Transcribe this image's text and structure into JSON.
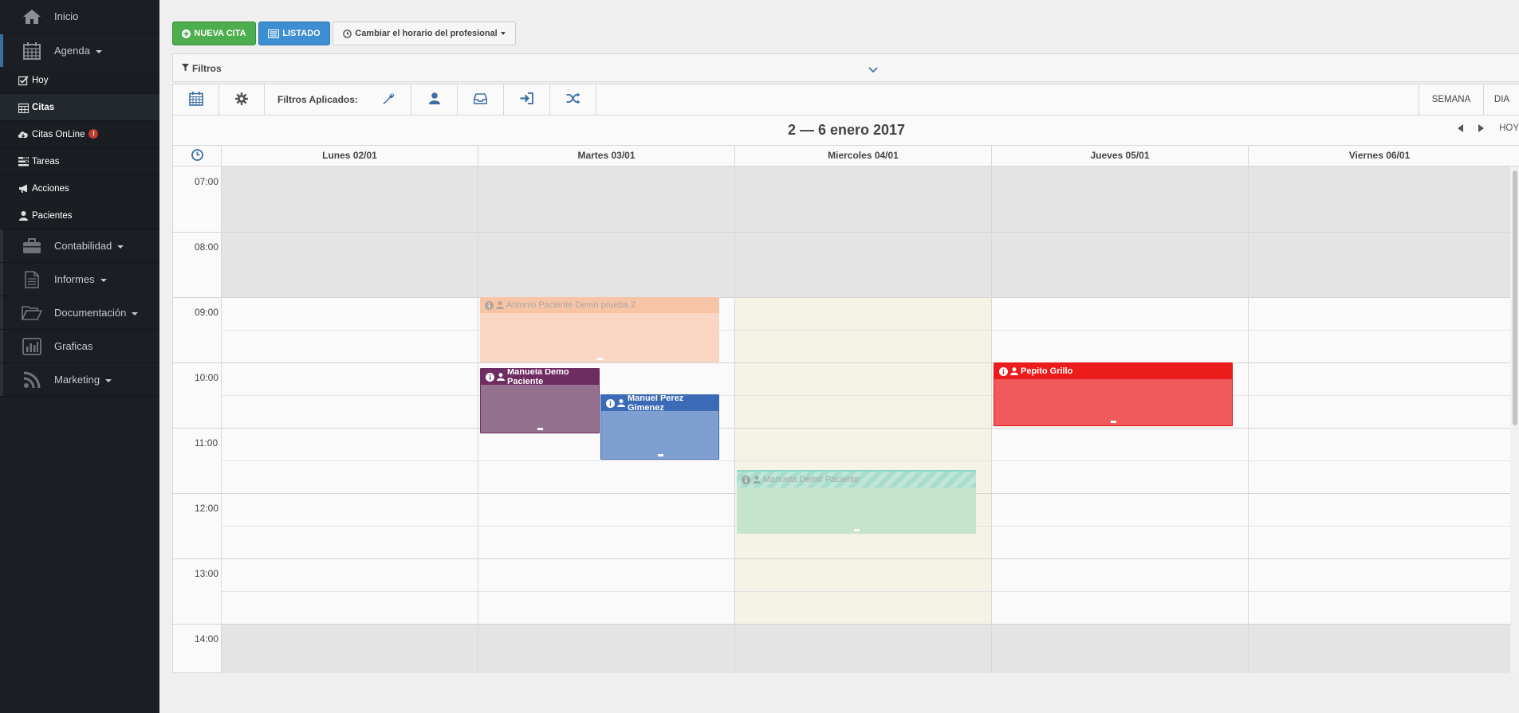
{
  "sidebar": {
    "items": [
      {
        "label": "Inicio",
        "icon": "home-icon"
      },
      {
        "label": "Agenda",
        "icon": "calendar-grid-icon"
      },
      {
        "label": "Hoy",
        "icon": "check-square-icon"
      },
      {
        "label": "Citas",
        "icon": "calendar-small-icon"
      },
      {
        "label": "Citas OnLine",
        "icon": "cloud-download-icon",
        "badge": "!"
      },
      {
        "label": "Tareas",
        "icon": "tasks-icon"
      },
      {
        "label": "Acciones",
        "icon": "bullhorn-icon"
      },
      {
        "label": "Pacientes",
        "icon": "user-icon"
      },
      {
        "label": "Contabilidad",
        "icon": "briefcase-icon"
      },
      {
        "label": "Informes",
        "icon": "document-icon"
      },
      {
        "label": "Documentación",
        "icon": "folder-open-icon"
      },
      {
        "label": "Graficas",
        "icon": "bar-chart-icon"
      },
      {
        "label": "Marketing",
        "icon": "rss-icon"
      }
    ]
  },
  "toolbar": {
    "new_label": "NUEVA CITA",
    "list_label": "LISTADO",
    "schedule_label": "Cambiar el horario del profesional"
  },
  "filters": {
    "title": "Filtros",
    "applied_label": "Filtros Aplicados:"
  },
  "views": {
    "week": "SEMANA",
    "day": "DIA",
    "today": "HOY"
  },
  "calendar": {
    "range_title": "2 — 6 enero 2017",
    "days": [
      "Lunes 02/01",
      "Martes 03/01",
      "Miercoles 04/01",
      "Jueves 05/01",
      "Viernes 06/01"
    ],
    "hours": [
      "07:00",
      "08:00",
      "09:00",
      "10:00",
      "11:00",
      "12:00",
      "13:00",
      "14:00"
    ],
    "events": [
      {
        "title": "Antonio Paciente Demo prueba 2",
        "day": "Martes 03/01",
        "start": "09:00",
        "end": "10:00",
        "color": "#f9d5c3",
        "header_color": "#f8c3a5",
        "state": "faded"
      },
      {
        "title": "Manuela Demo Paciente",
        "day": "Martes 03/01",
        "start": "10:05",
        "end": "11:05",
        "color": "#94728f",
        "header_color": "#6f2c61",
        "state": "normal"
      },
      {
        "title": "Manuel Perez Gimenez",
        "day": "Martes 03/01",
        "start": "10:30",
        "end": "11:30",
        "color": "#7e9fcf",
        "header_color": "#3b6bb6",
        "state": "normal"
      },
      {
        "title": "Pepito Grillo",
        "day": "Jueves 05/01",
        "start": "10:00",
        "end": "11:00",
        "color": "#f05a5a",
        "header_color": "#ec1c1c",
        "state": "normal"
      },
      {
        "title": "Manuela Demo Paciente",
        "day": "Miercoles 04/01",
        "start": "11:40",
        "end": "12:40",
        "color": "#c4e5c9",
        "header_color": "#a8dccc",
        "state": "faded-striped"
      }
    ]
  }
}
